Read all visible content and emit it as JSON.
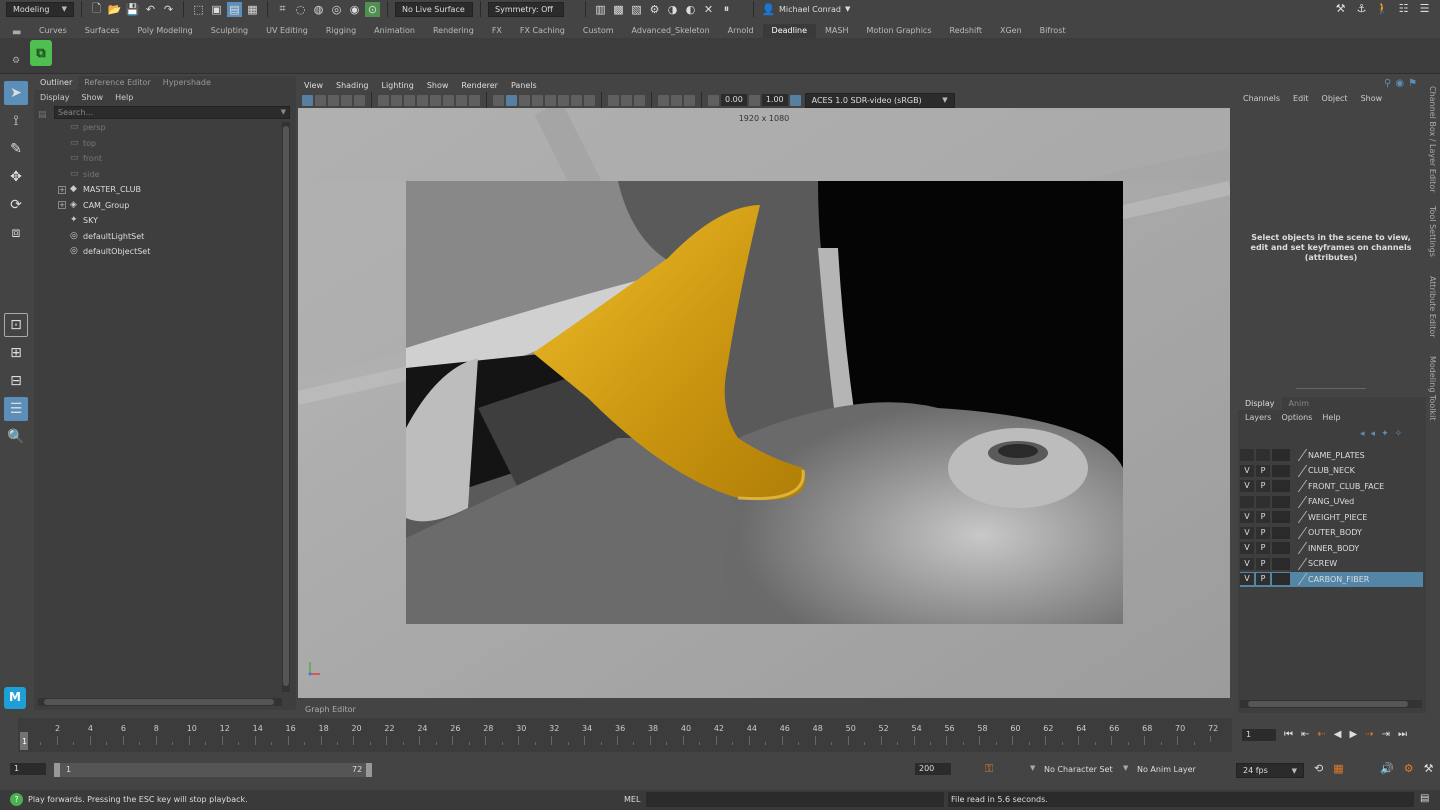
{
  "statusline": {
    "menu_set": "Modeling",
    "live_surface": "No Live Surface",
    "symmetry": "Symmetry: Off",
    "user": "Michael Conrad"
  },
  "shelf_tabs": [
    "Curves",
    "Surfaces",
    "Poly Modeling",
    "Sculpting",
    "UV Editing",
    "Rigging",
    "Animation",
    "Rendering",
    "FX",
    "FX Caching",
    "Custom",
    "Advanced_Skeleton",
    "Arnold",
    "Deadline",
    "MASH",
    "Motion Graphics",
    "Redshift",
    "XGen",
    "Bifrost"
  ],
  "shelf_active_tab": "Deadline",
  "outliner": {
    "tabs": [
      "Outliner",
      "Reference Editor",
      "Hypershade"
    ],
    "menu": [
      "Display",
      "Show",
      "Help"
    ],
    "search_placeholder": "Search...",
    "items": [
      {
        "label": "persp",
        "icon": "camera-icon",
        "dim": true,
        "expand": false
      },
      {
        "label": "top",
        "icon": "camera-icon",
        "dim": true,
        "expand": false
      },
      {
        "label": "front",
        "icon": "camera-icon",
        "dim": true,
        "expand": false
      },
      {
        "label": "side",
        "icon": "camera-icon",
        "dim": true,
        "expand": false
      },
      {
        "label": "MASTER_CLUB",
        "icon": "group-icon",
        "dim": false,
        "expand": true
      },
      {
        "label": "CAM_Group",
        "icon": "camera-group-icon",
        "dim": false,
        "expand": true
      },
      {
        "label": "SKY",
        "icon": "light-icon",
        "dim": false,
        "expand": false
      },
      {
        "label": "defaultLightSet",
        "icon": "set-icon",
        "dim": false,
        "expand": false
      },
      {
        "label": "defaultObjectSet",
        "icon": "set-icon",
        "dim": false,
        "expand": false
      }
    ]
  },
  "viewport": {
    "menu": [
      "View",
      "Shading",
      "Lighting",
      "Show",
      "Renderer",
      "Panels"
    ],
    "resolution": "1920 x 1080",
    "exposure": "0.00",
    "gamma": "1.00",
    "color_space": "ACES 1.0 SDR-video (sRGB)"
  },
  "graph_editor_label": "Graph Editor",
  "channel_box": {
    "menu": [
      "Channels",
      "Edit",
      "Object",
      "Show"
    ],
    "message": "Select objects in the scene to view, edit and set keyframes on channels (attributes)"
  },
  "side_tabs": [
    "Channel Box / Layer Editor",
    "Tool Settings",
    "Attribute Editor",
    "Modeling Toolkit"
  ],
  "layer_editor": {
    "tabs": [
      "Display",
      "Anim"
    ],
    "menu": [
      "Layers",
      "Options",
      "Help"
    ],
    "layers": [
      {
        "name": "NAME_PLATES",
        "v": "",
        "p": "",
        "selected": false
      },
      {
        "name": "CLUB_NECK",
        "v": "V",
        "p": "P",
        "selected": false
      },
      {
        "name": "FRONT_CLUB_FACE",
        "v": "V",
        "p": "P",
        "selected": false
      },
      {
        "name": "FANG_UVed",
        "v": "",
        "p": "",
        "selected": false
      },
      {
        "name": "WEIGHT_PIECE",
        "v": "V",
        "p": "P",
        "selected": false
      },
      {
        "name": "OUTER_BODY",
        "v": "V",
        "p": "P",
        "selected": false
      },
      {
        "name": "INNER_BODY",
        "v": "V",
        "p": "P",
        "selected": false
      },
      {
        "name": "SCREW",
        "v": "V",
        "p": "P",
        "selected": false
      },
      {
        "name": "CARBON_FIBER",
        "v": "V",
        "p": "P",
        "selected": true
      }
    ]
  },
  "timeline": {
    "ticks": [
      "2",
      "4",
      "6",
      "8",
      "10",
      "12",
      "14",
      "16",
      "18",
      "20",
      "22",
      "24",
      "26",
      "28",
      "30",
      "32",
      "34",
      "36",
      "38",
      "40",
      "42",
      "44",
      "46",
      "48",
      "50",
      "52",
      "54",
      "56",
      "58",
      "60",
      "62",
      "64",
      "66",
      "68",
      "70",
      "72"
    ],
    "current_frame": "1",
    "current_frame_field": "1"
  },
  "range": {
    "start": "1",
    "inner_start": "1",
    "inner_end": "72",
    "end": "200",
    "character_set": "No Character Set",
    "anim_layer": "No Anim Layer",
    "fps": "24 fps"
  },
  "command_line": {
    "help": "Play forwards. Pressing the ESC key will stop playback.",
    "lang": "MEL",
    "result": "File read in  5.6 seconds."
  },
  "colors": {
    "accent": "#5285a6",
    "fang": "#d9a215",
    "shelf_icon": "#4fbf4f"
  }
}
